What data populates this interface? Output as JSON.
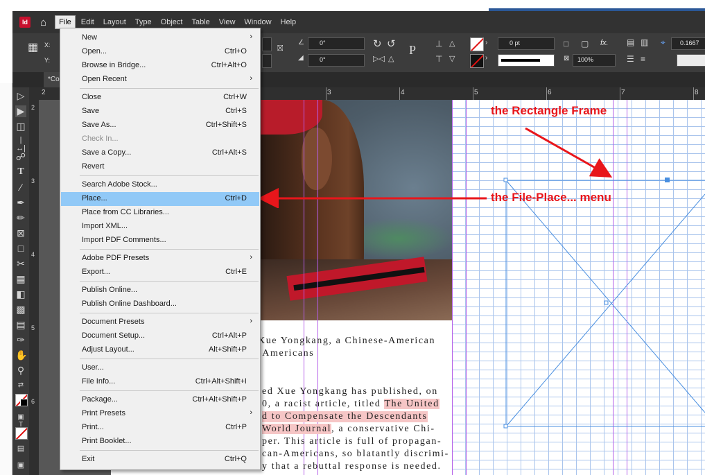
{
  "menubar": {
    "app_logo": "Id",
    "items": [
      "File",
      "Edit",
      "Layout",
      "Type",
      "Object",
      "Table",
      "View",
      "Window",
      "Help"
    ]
  },
  "controlbar": {
    "ref_x_label": "X:",
    "ref_y_label": "Y:",
    "angle_value": "0°",
    "shear_value": "0°",
    "stroke_weight": "0 pt",
    "opacity": "100%",
    "stroke_value": "0.1667",
    "p_icon": "P",
    "fx_icon": "fx."
  },
  "tabs": {
    "doc_tab": "*Co"
  },
  "ruler": {
    "h_numbers": [
      "2",
      "3",
      "4",
      "5",
      "6",
      "7",
      "8"
    ],
    "v_numbers": [
      "2",
      "3",
      "4",
      "5",
      "6"
    ]
  },
  "file_menu": {
    "items": [
      {
        "label": "New",
        "shortcut": "",
        "submenu": true
      },
      {
        "label": "Open...",
        "shortcut": "Ctrl+O"
      },
      {
        "label": "Browse in Bridge...",
        "shortcut": "Ctrl+Alt+O"
      },
      {
        "label": "Open Recent",
        "shortcut": "",
        "submenu": true
      },
      {
        "label": "Close",
        "shortcut": "Ctrl+W"
      },
      {
        "label": "Save",
        "shortcut": "Ctrl+S"
      },
      {
        "label": "Save As...",
        "shortcut": "Ctrl+Shift+S"
      },
      {
        "label": "Check In...",
        "shortcut": "",
        "disabled": true
      },
      {
        "label": "Save a Copy...",
        "shortcut": "Ctrl+Alt+S"
      },
      {
        "label": "Revert",
        "shortcut": ""
      },
      {
        "label": "Search Adobe Stock...",
        "shortcut": ""
      },
      {
        "label": "Place...",
        "shortcut": "Ctrl+D",
        "highlighted": true
      },
      {
        "label": "Place from CC Libraries...",
        "shortcut": ""
      },
      {
        "label": "Import XML...",
        "shortcut": ""
      },
      {
        "label": "Import PDF Comments...",
        "shortcut": ""
      },
      {
        "label": "Adobe PDF Presets",
        "shortcut": "",
        "submenu": true
      },
      {
        "label": "Export...",
        "shortcut": "Ctrl+E"
      },
      {
        "label": "Publish Online...",
        "shortcut": ""
      },
      {
        "label": "Publish Online Dashboard...",
        "shortcut": ""
      },
      {
        "label": "Document Presets",
        "shortcut": "",
        "submenu": true
      },
      {
        "label": "Document Setup...",
        "shortcut": "Ctrl+Alt+P"
      },
      {
        "label": "Adjust Layout...",
        "shortcut": "Alt+Shift+P"
      },
      {
        "label": "User...",
        "shortcut": ""
      },
      {
        "label": "File Info...",
        "shortcut": "Ctrl+Alt+Shift+I"
      },
      {
        "label": "Package...",
        "shortcut": "Ctrl+Alt+Shift+P"
      },
      {
        "label": "Print Presets",
        "shortcut": "",
        "submenu": true
      },
      {
        "label": "Print...",
        "shortcut": "Ctrl+P"
      },
      {
        "label": "Print Booklet...",
        "shortcut": ""
      },
      {
        "label": "Exit",
        "shortcut": "Ctrl+Q"
      }
    ]
  },
  "article": {
    "line1": "Xue Yongkang, a Chinese-American",
    "line2": "-Americans",
    "line3": "ed Xue Yongkang has published, on",
    "line4a": "0, a racist article, titled ",
    "line4b": "The United",
    "line5": "d to Compensate the Descendants",
    "line6a": "World Journal",
    "line6b": ", a conservative Chi-",
    "line7": "per. This article is full of propagan-",
    "line8": "can-Americans, so blatantly discrimi-",
    "line9": "y that a rebuttal response is needed."
  },
  "annotations": {
    "rect_frame": "the Rectangle Frame",
    "file_place": "the File-Place... menu"
  },
  "colors": {
    "annotation_red": "#e8161b",
    "menu_highlight": "#91c9f7",
    "guide_purple": "#b45ee8",
    "grid_blue": "#a9c4ec",
    "frame_blue": "#4a8fe0"
  }
}
